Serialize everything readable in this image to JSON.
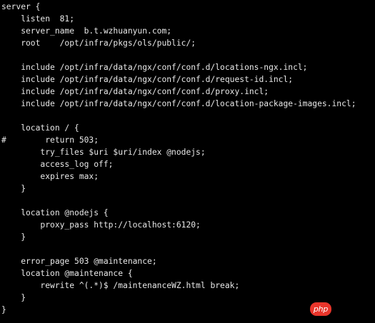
{
  "config_lines": [
    "server {",
    "    listen  81;",
    "    server_name  b.t.wzhuanyun.com;",
    "    root    /opt/infra/pkgs/ols/public/;",
    "",
    "    include /opt/infra/data/ngx/conf/conf.d/locations-ngx.incl;",
    "    include /opt/infra/data/ngx/conf/conf.d/request-id.incl;",
    "    include /opt/infra/data/ngx/conf/conf.d/proxy.incl;",
    "    include /opt/infra/data/ngx/conf/conf.d/location-package-images.incl;",
    "",
    "    location / {",
    "#        return 503;",
    "        try_files $uri $uri/index @nodejs;",
    "        access_log off;",
    "        expires max;",
    "    }",
    "",
    "    location @nodejs {",
    "        proxy_pass http://localhost:6120;",
    "    }",
    "",
    "    error_page 503 @maintenance;",
    "    location @maintenance {",
    "        rewrite ^(.*)$ /maintenanceWZ.html break;",
    "    }",
    "}"
  ],
  "watermark": {
    "text": "php"
  },
  "colors": {
    "background": "#000000",
    "text": "#e8e8e8",
    "watermark_bg": "#e9352b"
  }
}
